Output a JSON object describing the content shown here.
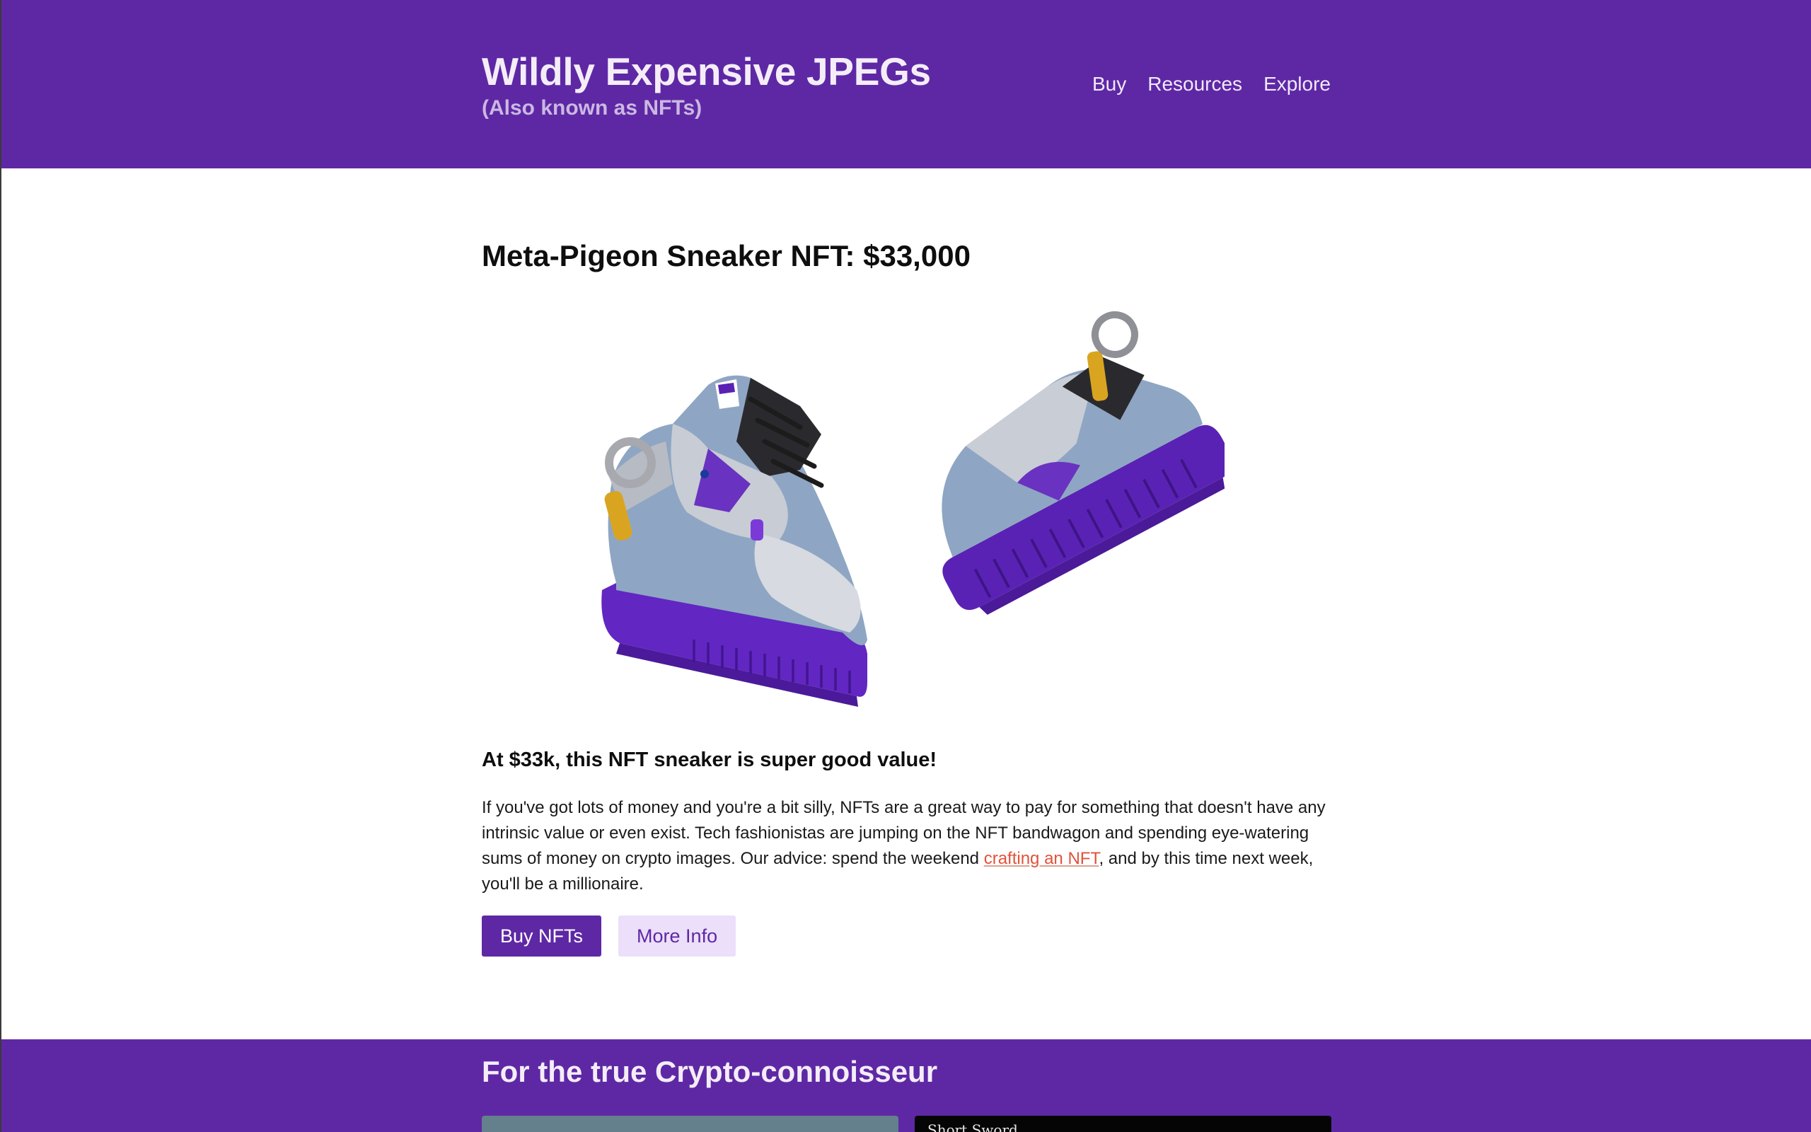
{
  "header": {
    "title": "Wildly Expensive JPEGs",
    "subtitle": "(Also known as NFTs)",
    "nav": [
      {
        "label": "Buy"
      },
      {
        "label": "Resources"
      },
      {
        "label": "Explore"
      }
    ],
    "background_color": "#5e28a5"
  },
  "product": {
    "title": "Meta-Pigeon Sneaker NFT: $33,000",
    "image_alt": "Meta-Pigeon sneaker pair in purple, silver and blue",
    "tagline": "At $33k, this NFT sneaker is super good value!",
    "body_before_link": "If you've got lots of money and you're a bit silly, NFTs are a great way to pay for something that doesn't have any intrinsic value or even exist. Tech fashionistas are jumping on the NFT bandwagon and spending eye-watering sums of money on crypto images. Our advice: spend the weekend ",
    "link_text": "crafting an NFT",
    "body_after_link": ", and by this time next week, you'll be a millionaire.",
    "buttons": {
      "primary": "Buy NFTs",
      "secondary": "More Info"
    }
  },
  "connoisseur": {
    "title": "For the true Crypto-connoisseur",
    "cards": [
      {
        "label": ""
      },
      {
        "label": "Short Sword"
      }
    ]
  },
  "colors": {
    "accent": "#5e28a5",
    "accent_light": "#ecdff9",
    "link": "#e0533b"
  }
}
